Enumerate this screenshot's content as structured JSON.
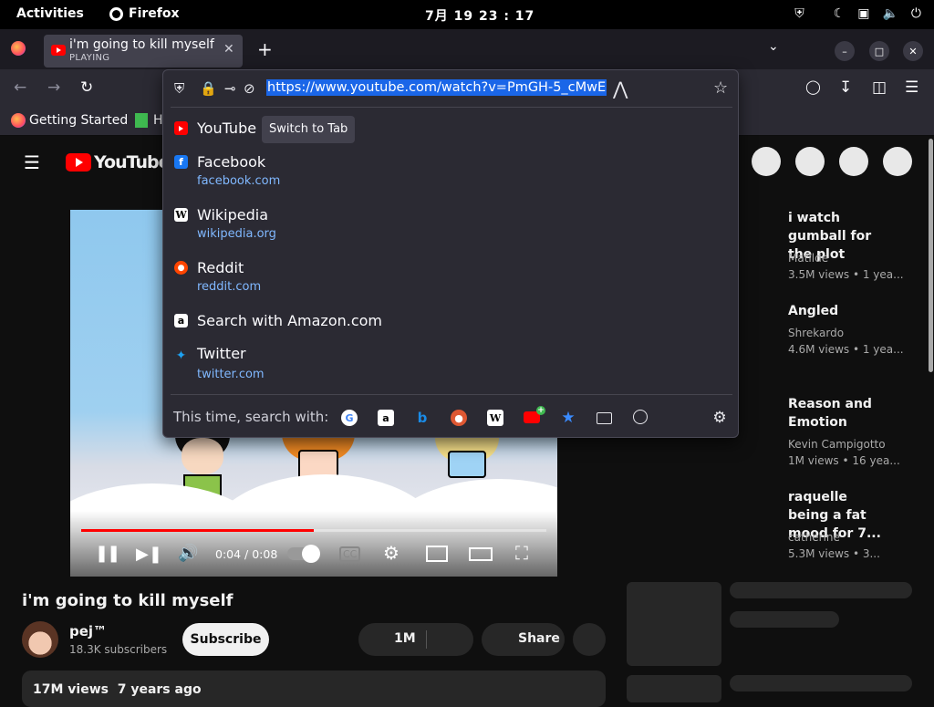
{
  "gnome": {
    "activities": "Activities",
    "app_name": "Firefox",
    "clock": "7月 19 23 : 17"
  },
  "tab": {
    "title": "i'm going to kill myself",
    "status": "PLAYING"
  },
  "bookmarks": {
    "items": [
      "Getting Started",
      "H"
    ]
  },
  "urlbar": {
    "url": "https://www.youtube.com/watch?v=PmGH-5_cMwE"
  },
  "suggestions": [
    {
      "title": "YouTube",
      "url": "",
      "action": "Switch to Tab",
      "icon": "youtube-icon"
    },
    {
      "title": "Facebook",
      "url": "facebook.com",
      "icon": "facebook-icon"
    },
    {
      "title": "Wikipedia",
      "url": "wikipedia.org",
      "icon": "wikipedia-icon"
    },
    {
      "title": "Reddit",
      "url": "reddit.com",
      "icon": "reddit-icon"
    },
    {
      "title": "Search with Amazon.com",
      "url": "",
      "icon": "amazon-icon"
    },
    {
      "title": "Twitter",
      "url": "twitter.com",
      "icon": "twitter-icon"
    }
  ],
  "search_with": {
    "label": "This time, search with:",
    "engines": [
      "google-icon",
      "amazon-icon",
      "bing-icon",
      "duckduckgo-icon",
      "wikipedia-icon",
      "youtube-add-icon",
      "bookmarks-icon",
      "tabs-icon",
      "history-icon"
    ]
  },
  "youtube": {
    "logo_text": "YouTube",
    "video_title": "i'm going to kill myself",
    "channel": "pej™",
    "subscribers": "18.3K subscribers",
    "subscribe_label": "Subscribe",
    "likes": "1M",
    "share_label": "Share",
    "views_date": "17M views  7 years ago",
    "time": "0:04 / 0:08",
    "progress": 0.5
  },
  "recommendations": [
    {
      "title": "i watch gumball for the plot",
      "channel": "Matilde",
      "meta": "3.5M views  • 1 yea..."
    },
    {
      "title": "Angled",
      "channel": "Shrekardo",
      "meta": "4.6M views  • 1 yea..."
    },
    {
      "title": "Reason and Emotion",
      "channel": "Kevin Campigotto",
      "meta": "1M views  • 16 yea..."
    },
    {
      "title": "raquelle being a fat mood for 7...",
      "channel": "catherine",
      "meta": "5.3M views  • 3..."
    }
  ]
}
